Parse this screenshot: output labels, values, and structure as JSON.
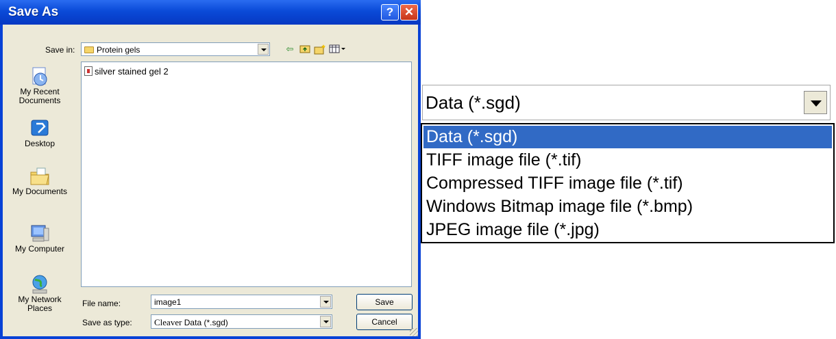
{
  "dialog": {
    "title": "Save As",
    "save_in_label": "Save in:",
    "save_in_value": "Protein gels",
    "places": [
      {
        "label": "My Recent Documents",
        "icon": "recent-documents-icon"
      },
      {
        "label": "Desktop",
        "icon": "desktop-icon"
      },
      {
        "label": "My Documents",
        "icon": "my-documents-icon"
      },
      {
        "label": "My Computer",
        "icon": "my-computer-icon"
      },
      {
        "label": "My Network Places",
        "icon": "network-places-icon"
      }
    ],
    "files": [
      "silver stained gel 2"
    ],
    "file_name_label": "File name:",
    "file_name_value": "image1",
    "save_type_label": "Save as type:",
    "save_type_prefix": "Cleaver",
    "save_type_value": "Data (*.sgd)",
    "save_button": "Save",
    "cancel_button": "Cancel",
    "help_button": "?",
    "close_button": "✕"
  },
  "zoomed_dropdown": {
    "selected": "Data (*.sgd)",
    "options": [
      "Data (*.sgd)",
      "TIFF image file (*.tif)",
      "Compressed TIFF image file (*.tif)",
      "Windows Bitmap image file (*.bmp)",
      "JPEG image file (*.jpg)"
    ],
    "highlighted_index": 0
  },
  "colors": {
    "titlebar": "#0a4ad8",
    "dialog_face": "#ece9d8",
    "selection": "#316ac5",
    "close_button": "#c6351a"
  }
}
